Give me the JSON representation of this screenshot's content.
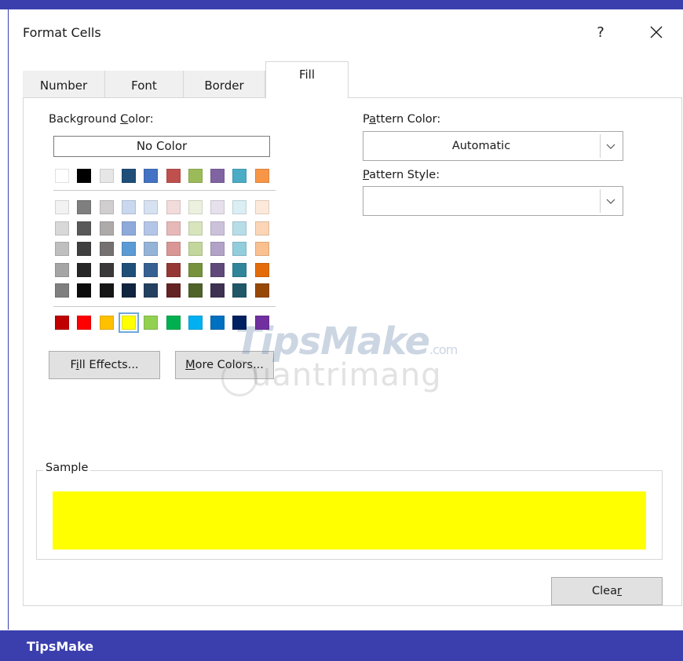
{
  "window": {
    "title": "Format Cells",
    "help_label": "?"
  },
  "colors": {
    "accent": "#3b3fae",
    "sample_fill": "#ffff00",
    "selected_border": "#6fa8dc"
  },
  "tabs": [
    {
      "label": "Number",
      "active": false
    },
    {
      "label": "Font",
      "active": false
    },
    {
      "label": "Border",
      "active": false
    },
    {
      "label": "Fill",
      "active": true
    }
  ],
  "background": {
    "label_pre": "Background ",
    "label_u": "C",
    "label_post": "olor:",
    "no_color_label": "No Color",
    "top_row": [
      "#ffffff",
      "#000000",
      "#e7e6e6",
      "#1f4e79",
      "#4472c4",
      "#c0504d",
      "#9bbb59",
      "#8064a2",
      "#4bacc6",
      "#f79646"
    ],
    "theme_rows": [
      [
        "#f2f2f2",
        "#7f7f7f",
        "#d0cece",
        "#c9d8ee",
        "#d6e1f1",
        "#f2dcdb",
        "#ebf1de",
        "#e5e0ec",
        "#dbeef3",
        "#fde9d9"
      ],
      [
        "#d8d8d8",
        "#595959",
        "#aeaaaa",
        "#8eaadb",
        "#b4c6e7",
        "#e6b8b7",
        "#d7e4bc",
        "#ccc1da",
        "#b7dde8",
        "#fbd5b5"
      ],
      [
        "#bfbfbf",
        "#3f3f3f",
        "#767171",
        "#5b9bd5",
        "#95b3d7",
        "#d99694",
        "#c3d69b",
        "#b2a2c7",
        "#92cddc",
        "#fac08f"
      ],
      [
        "#a5a5a5",
        "#262626",
        "#3a3838",
        "#1f4e79",
        "#366092",
        "#953734",
        "#76923c",
        "#5f497a",
        "#31859b",
        "#e36c09"
      ],
      [
        "#7f7f7f",
        "#0c0c0c",
        "#171616",
        "#0f243e",
        "#244061",
        "#632423",
        "#4f6228",
        "#3f3151",
        "#205867",
        "#974806"
      ]
    ],
    "standard_row": [
      "#c00000",
      "#ff0000",
      "#ffc000",
      "#ffff00",
      "#92d050",
      "#00b050",
      "#00b0f0",
      "#0070c0",
      "#002060",
      "#7030a0"
    ],
    "selected_standard_index": 3,
    "fill_effects": {
      "pre": "F",
      "u": "i",
      "post": "ll Effects..."
    },
    "more_colors": {
      "pre": "",
      "u": "M",
      "post": "ore Colors..."
    }
  },
  "pattern_color": {
    "pre": "P",
    "u": "a",
    "post": "ttern Color:",
    "value": "Automatic"
  },
  "pattern_style": {
    "pre": "",
    "u": "P",
    "post": "attern Style:",
    "value": ""
  },
  "sample": {
    "label": "Sample"
  },
  "clear_button": {
    "pre": "Clea",
    "u": "r",
    "post": ""
  },
  "watermark": {
    "line1": "TipsMake",
    "line1_small": ".com",
    "line2": "uantrimang"
  },
  "footer": {
    "text": "TipsMake"
  }
}
